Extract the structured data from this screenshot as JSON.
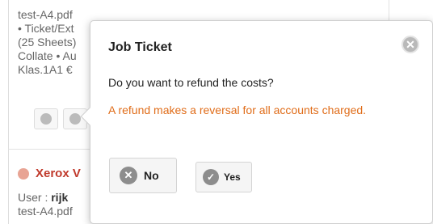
{
  "background": {
    "entry_lines": [
      "test-A4.pdf",
      "• Ticket/Ext",
      "(25 Sheets)",
      "Collate • Au",
      "Klas.1A1 €"
    ],
    "printer_name": "Xerox V",
    "user_label": "User : ",
    "user_name": "rijk",
    "file_name": "test-A4.pdf"
  },
  "dialog": {
    "title": "Job Ticket",
    "question": "Do you want to refund the costs?",
    "warning": "A refund makes a reversal for all accounts charged.",
    "no_label": "No",
    "yes_label": "Yes",
    "close_glyph": "✕",
    "no_glyph": "✕",
    "yes_glyph": "✓"
  },
  "colors": {
    "warning": "#e06d1a",
    "printer_name": "#c0392b",
    "status_dot": "#e8a494"
  },
  "icons": {
    "close": "close-icon",
    "no": "cancel-circle-icon",
    "yes": "check-circle-icon"
  }
}
